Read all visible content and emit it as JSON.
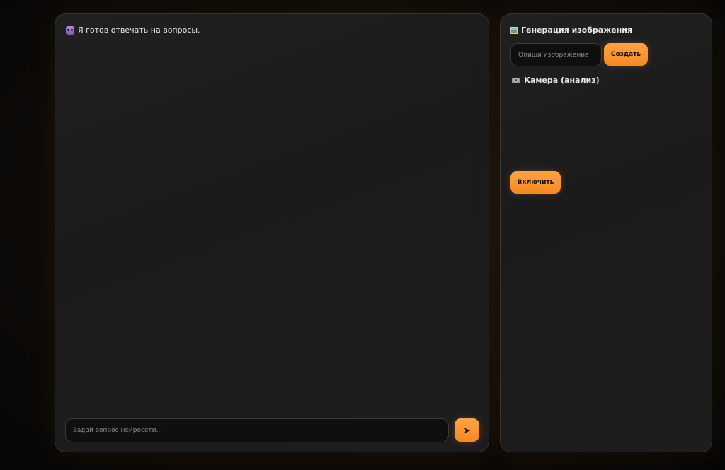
{
  "chat": {
    "welcome_icon": "robot-icon",
    "welcome_text": "Я готов отвечать на вопросы.",
    "input_placeholder": "Задай вопрос нейросети...",
    "send_label": "➤"
  },
  "generation": {
    "icon": "picture-frame-icon",
    "title": "Генерация изображения",
    "input_placeholder": "Опиши изображение",
    "create_label": "Создать"
  },
  "camera": {
    "icon": "camera-icon",
    "title": "Камера (анализ)",
    "enable_label": "Включить"
  },
  "colors": {
    "accent": "#f7922e",
    "panel_bg": "#1e1e1e",
    "page_bg": "#0b0a09"
  }
}
